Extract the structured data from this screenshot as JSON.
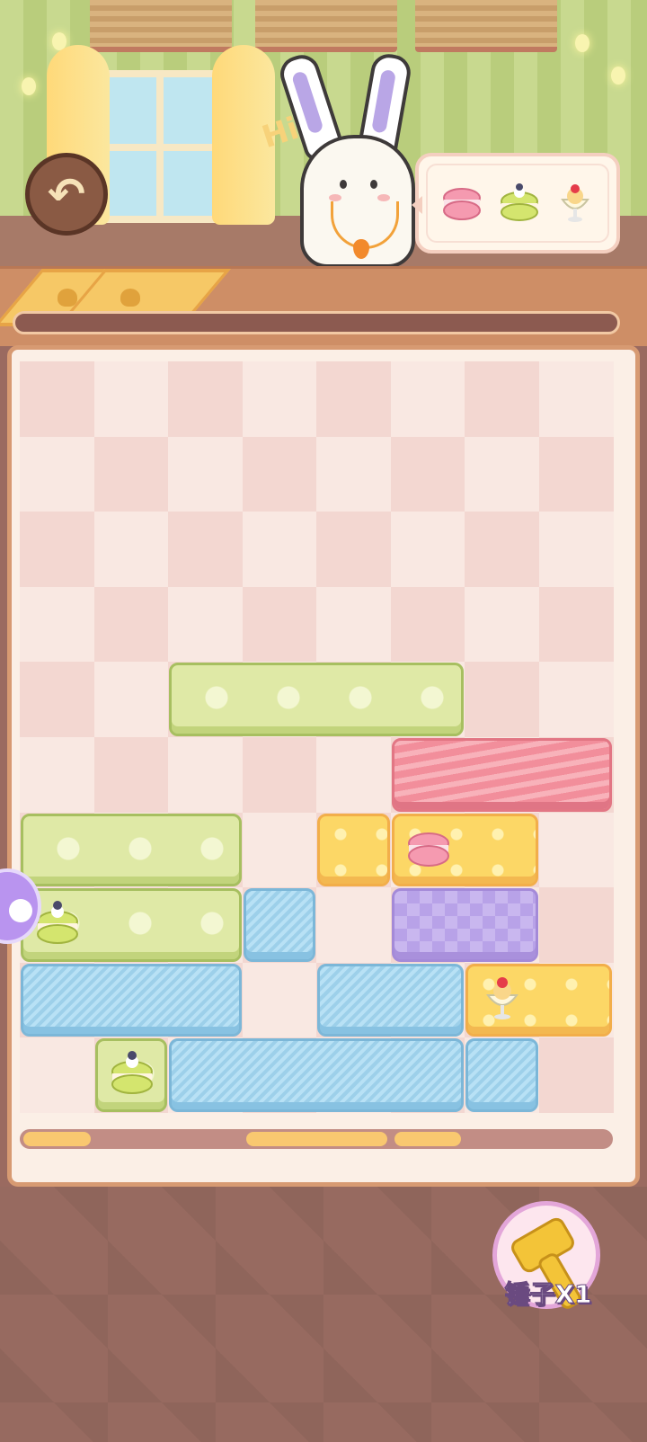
{
  "scene": {
    "greeting": "Hi"
  },
  "order": {
    "items": [
      {
        "icon": "pink-macaron-icon"
      },
      {
        "icon": "green-cake-macaron-icon"
      },
      {
        "icon": "ice-cream-sundae-icon"
      }
    ]
  },
  "buttons": {
    "back_icon": "undo-arrow-icon",
    "hammer_label": "锤子X1"
  },
  "board": {
    "columns": 8,
    "rows": 10,
    "blocks": [
      {
        "color": "green",
        "col": 2,
        "row": 4,
        "w": 4,
        "item": null
      },
      {
        "color": "pink",
        "col": 5,
        "row": 5,
        "w": 3,
        "item": null
      },
      {
        "color": "green",
        "col": 0,
        "row": 6,
        "w": 3,
        "item": null
      },
      {
        "color": "yellow",
        "col": 4,
        "row": 6,
        "w": 1,
        "item": null
      },
      {
        "color": "yellow",
        "col": 5,
        "row": 6,
        "w": 2,
        "item": "pink-macaron"
      },
      {
        "color": "green",
        "col": 0,
        "row": 7,
        "w": 3,
        "item": "green-cake-macaron"
      },
      {
        "color": "blue",
        "col": 3,
        "row": 7,
        "w": 1,
        "item": null
      },
      {
        "color": "purple",
        "col": 5,
        "row": 7,
        "w": 2,
        "item": null
      },
      {
        "color": "blue",
        "col": 0,
        "row": 8,
        "w": 3,
        "item": null
      },
      {
        "color": "blue",
        "col": 4,
        "row": 8,
        "w": 2,
        "item": null
      },
      {
        "color": "yellow",
        "col": 6,
        "row": 8,
        "w": 2,
        "item": "ice-cream-sundae"
      },
      {
        "color": "green",
        "col": 1,
        "row": 9,
        "w": 1,
        "item": "green-cake-macaron"
      },
      {
        "color": "blue",
        "col": 2,
        "row": 9,
        "w": 4,
        "item": null
      },
      {
        "color": "blue",
        "col": 6,
        "row": 9,
        "w": 1,
        "item": null
      }
    ]
  },
  "column_indicators": [
    {
      "col": 0,
      "w": 1
    },
    {
      "col": 3,
      "w": 2
    },
    {
      "col": 5,
      "w": 1
    }
  ],
  "colors": {
    "green": "#dfe9a6",
    "pink": "#f59aa5",
    "yellow": "#fcd766",
    "purple": "#c9b7ef",
    "blue": "#a9d9f1"
  }
}
